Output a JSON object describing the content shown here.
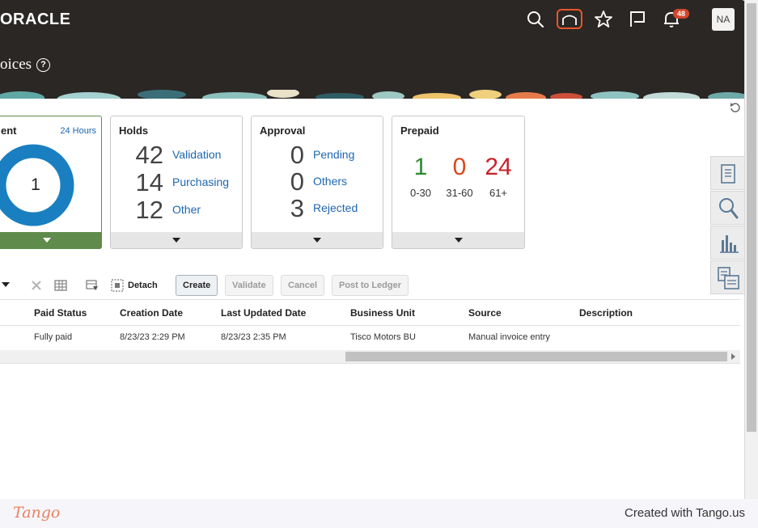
{
  "header": {
    "brand": "ORACLE",
    "page_title": "oices",
    "help_icon": "?",
    "notification_count": "48",
    "avatar_initials": "NA",
    "icons": [
      "search-icon",
      "home-icon",
      "star-icon",
      "flag-icon",
      "bell-icon"
    ]
  },
  "tiles": {
    "payment": {
      "title": "ent",
      "range": "24 Hours",
      "count": "1"
    },
    "holds": {
      "title": "Holds",
      "rows": [
        {
          "value": "42",
          "label": "Validation"
        },
        {
          "value": "14",
          "label": "Purchasing"
        },
        {
          "value": "12",
          "label": "Other"
        }
      ]
    },
    "approval": {
      "title": "Approval",
      "rows": [
        {
          "value": "0",
          "label": "Pending"
        },
        {
          "value": "0",
          "label": "Others"
        },
        {
          "value": "3",
          "label": "Rejected"
        }
      ]
    },
    "prepaid": {
      "title": "Prepaid",
      "buckets": [
        {
          "value": "1",
          "label": "0-30",
          "color": "#2e8b2e"
        },
        {
          "value": "0",
          "label": "31-60",
          "color": "#d9481a"
        },
        {
          "value": "24",
          "label": "61+",
          "color": "#c8222a"
        }
      ]
    }
  },
  "toolbar": {
    "detach": "Detach",
    "create": "Create",
    "validate": "Validate",
    "cancel": "Cancel",
    "post_to_ledger": "Post to Ledger"
  },
  "table": {
    "columns": [
      "Paid Status",
      "Creation Date",
      "Last Updated Date",
      "Business Unit",
      "Source",
      "Description"
    ],
    "rows": [
      [
        "Fully paid",
        "8/23/23 2:29 PM",
        "8/23/23 2:35 PM",
        "Tisco Motors BU",
        "Manual invoice entry",
        ""
      ]
    ]
  },
  "side_panel": [
    "document-icon",
    "magnifier-icon",
    "bar-chart-icon",
    "list-compare-icon"
  ],
  "footer": {
    "logo": "Tango",
    "credit": "Created with Tango.us"
  },
  "colors": {
    "header_bg": "#2b2725",
    "link": "#1e66b0",
    "donut": "#1a7fc1",
    "payment_footer": "#5f8b4c",
    "home_highlight": "#e8562a"
  }
}
